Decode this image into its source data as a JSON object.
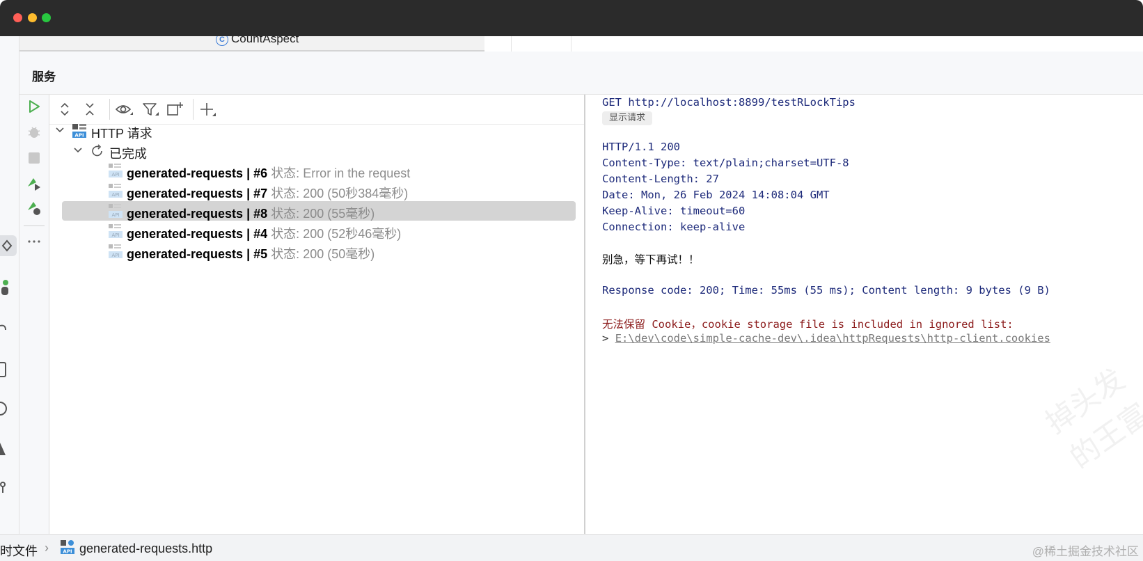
{
  "editor": {
    "tab_label": "CountAspect",
    "tab_icon": "java-class-icon"
  },
  "services": {
    "title": "服务"
  },
  "tree": {
    "root_label": "HTTP 请求",
    "group_label": "已完成",
    "items": [
      {
        "name": "generated-requests",
        "sep": "|",
        "num": "#6",
        "status": "状态: Error in the request",
        "selected": false
      },
      {
        "name": "generated-requests",
        "sep": "|",
        "num": "#7",
        "status": "状态: 200 (50秒384毫秒)",
        "selected": false
      },
      {
        "name": "generated-requests",
        "sep": "|",
        "num": "#8",
        "status": "状态: 200 (55毫秒)",
        "selected": true
      },
      {
        "name": "generated-requests",
        "sep": "|",
        "num": "#4",
        "status": "状态: 200 (52秒46毫秒)",
        "selected": false
      },
      {
        "name": "generated-requests",
        "sep": "|",
        "num": "#5",
        "status": "状态: 200 (50毫秒)",
        "selected": false
      }
    ]
  },
  "response": {
    "request_line": "GET http://localhost:8899/testRLockTips",
    "show_request_label": "显示请求",
    "status_line": "HTTP/1.1 200",
    "headers": [
      "Content-Type: text/plain;charset=UTF-8",
      "Content-Length: 27",
      "Date: Mon, 26 Feb 2024 14:08:04 GMT",
      "Keep-Alive: timeout=60",
      "Connection: keep-alive"
    ],
    "body": "别急，等下再试！！",
    "summary": "Response code: 200; Time: 55ms (55 ms); Content length: 9 bytes (9 B)",
    "warning": "无法保留 Cookie，cookie storage file is included in ignored list:",
    "cookie_prefix": ">",
    "cookie_path": "E:\\dev\\code\\simple-cache-dev\\.idea\\httpRequests\\http-client.cookies",
    "watermark_text": "掉头发的王富"
  },
  "statusbar": {
    "crumb_1": "时文件",
    "crumb_sep": "›",
    "crumb_2": "generated-requests.http",
    "watermark": "@稀土掘金技术社区"
  },
  "colors": {
    "titlebar": "#2b2b2b",
    "selection": "#d4d4d4",
    "http_text": "#1d2a7a",
    "warning_text": "#8b1a1a",
    "run_green": "#4caf50"
  }
}
